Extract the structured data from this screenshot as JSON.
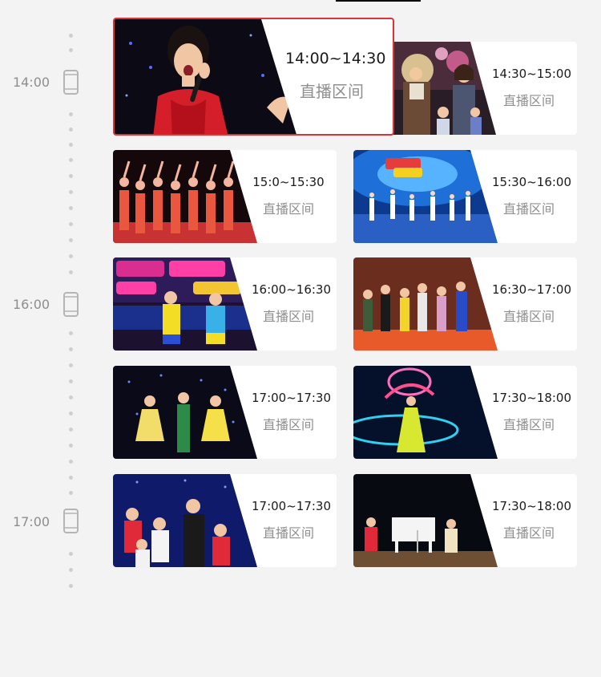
{
  "timeline": {
    "labels": [
      "14:00",
      "16:00",
      "17:00"
    ]
  },
  "status_text": "直播区间",
  "cards": [
    {
      "id": "c1",
      "time": "14:00~14:30",
      "status": "直播区间",
      "thumb": "girl-singer-red-dress",
      "active": true
    },
    {
      "id": "c2",
      "time": "14:30~15:00",
      "status": "直播区间",
      "thumb": "guests-on-stage"
    },
    {
      "id": "c3",
      "time": "15:0~15:30",
      "status": "直播区间",
      "thumb": "dancers-line"
    },
    {
      "id": "c4",
      "time": "15:30~16:00",
      "status": "直播区间",
      "thumb": "blue-stage-dance"
    },
    {
      "id": "c5",
      "time": "16:00~16:30",
      "status": "直播区间",
      "thumb": "two-girls-singing"
    },
    {
      "id": "c6",
      "time": "16:30~17:00",
      "status": "直播区间",
      "thumb": "costumed-children"
    },
    {
      "id": "c7",
      "time": "17:00~17:30",
      "status": "直播区间",
      "thumb": "three-performers"
    },
    {
      "id": "c8",
      "time": "17:30~18:00",
      "status": "直播区间",
      "thumb": "ribbon-dancer"
    },
    {
      "id": "c9",
      "time": "17:00~17:30",
      "status": "直播区间",
      "thumb": "group-kids-stage"
    },
    {
      "id": "c10",
      "time": "17:30~18:00",
      "status": "直播区间",
      "thumb": "piano-stage"
    }
  ],
  "colors": {
    "accent": "#d9343a",
    "background": "#f3f3f3",
    "card": "#ffffff",
    "time_text": "#1a1a1a",
    "status_text": "#8f8f8f",
    "timeline": "#cfcfcf"
  }
}
